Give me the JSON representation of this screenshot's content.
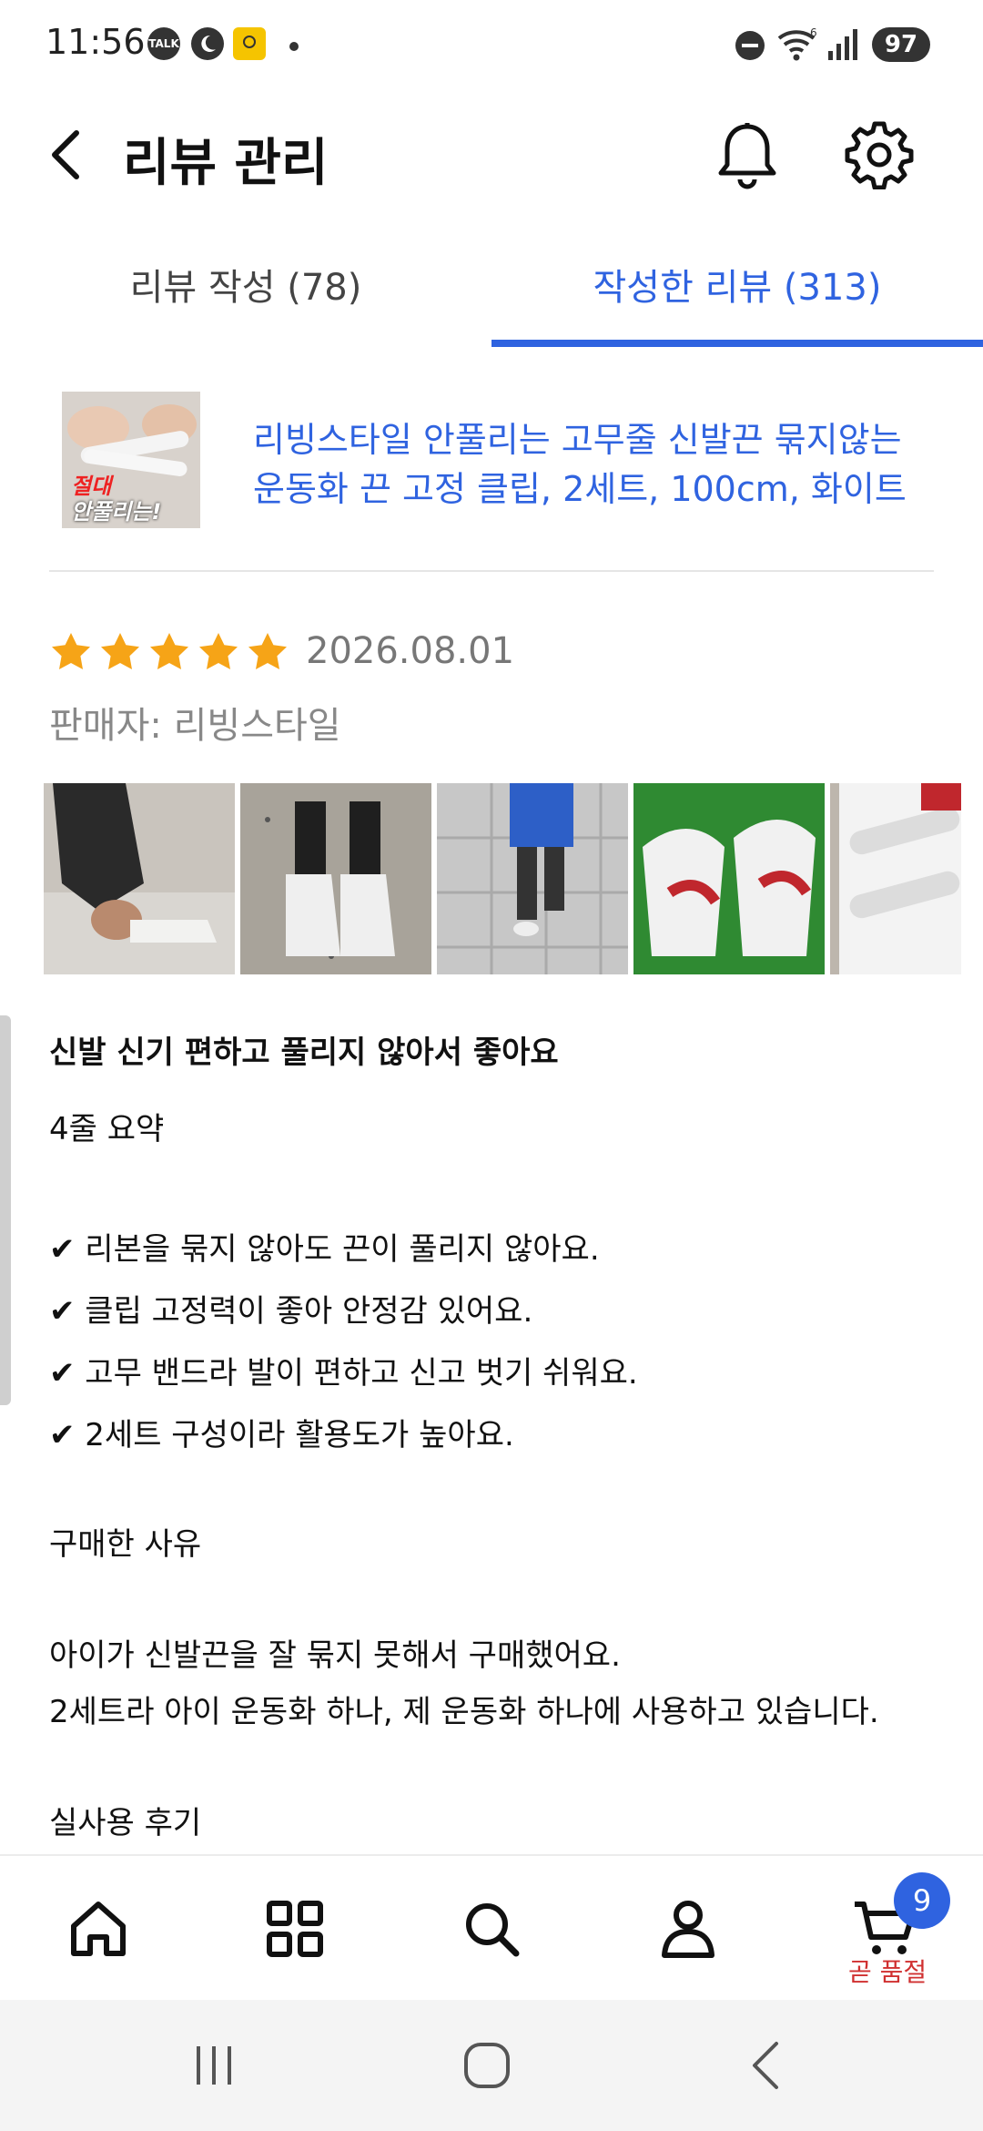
{
  "status_bar": {
    "time": "11:56",
    "talk_badge": "TALK",
    "battery": "97"
  },
  "header": {
    "title": "리뷰 관리"
  },
  "tabs": [
    {
      "label": "리뷰 작성 (78)",
      "active": false
    },
    {
      "label": "작성한 리뷰 (313)",
      "active": true
    }
  ],
  "product": {
    "thumb_text_1": "절대",
    "thumb_text_2": "안풀리는!",
    "title_line1": "리빙스타일 안풀리는 고무줄 신발끈 묶지않는",
    "title_line2": "운동화 끈 고정 클립, 2세트, 100cm, 화이트"
  },
  "review": {
    "rating": 5,
    "date": "2026.08.01",
    "seller": "판매자: 리빙스타일",
    "headline": "신발 신기 편하고 풀리지 않아서 좋아요",
    "summary_heading": "4줄 요약",
    "points": [
      "✔ 리본을 묶지 않아도 끈이 풀리지 않아요.",
      "✔ 클립 고정력이 좋아 안정감 있어요.",
      "✔ 고무 밴드라 발이 편하고 신고 벗기 쉬워요.",
      "✔ 2세트 구성이라 활용도가 높아요."
    ],
    "reason_heading": "구매한 사유",
    "reason_lines": [
      "아이가 신발끈을 잘 묶지 못해서 구매했어요.",
      "2세트라 아이 운동화 하나, 제 운동화 하나에 사용하고 있습니다."
    ],
    "usage_heading": "실사용 후기"
  },
  "bottom_nav": {
    "cart_badge": "9",
    "cart_label": "곧 품절"
  },
  "colors": {
    "accent": "#2f63e0",
    "star": "#f6a417",
    "soldout": "#d03030"
  }
}
